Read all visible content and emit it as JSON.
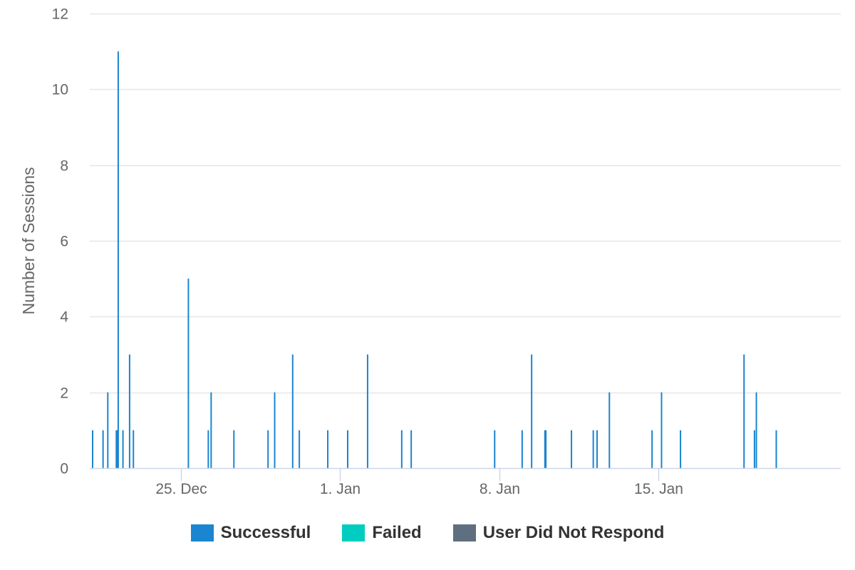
{
  "chart_data": {
    "type": "bar",
    "ylabel": "Number of Sessions",
    "ylim": [
      0,
      12
    ],
    "yticks": [
      0,
      2,
      4,
      6,
      8,
      10,
      12
    ],
    "x_range": [
      "2024-12-21",
      "2025-01-23"
    ],
    "xticks": [
      {
        "date": "2024-12-25",
        "label": "25. Dec"
      },
      {
        "date": "2025-01-01",
        "label": "1. Jan"
      },
      {
        "date": "2025-01-08",
        "label": "8. Jan"
      },
      {
        "date": "2025-01-15",
        "label": "15. Jan"
      }
    ],
    "legend_position": "bottom",
    "series": [
      {
        "name": "Successful",
        "color": "#1a85d0",
        "points": [
          {
            "x": "2024-12-21 03:00",
            "y": 1
          },
          {
            "x": "2024-12-21 14:00",
            "y": 1
          },
          {
            "x": "2024-12-21 19:00",
            "y": 2
          },
          {
            "x": "2024-12-22 04:00",
            "y": 1
          },
          {
            "x": "2024-12-22 05:00",
            "y": 1
          },
          {
            "x": "2024-12-22 06:00",
            "y": 11
          },
          {
            "x": "2024-12-22 11:00",
            "y": 1
          },
          {
            "x": "2024-12-22 18:00",
            "y": 3
          },
          {
            "x": "2024-12-22 22:00",
            "y": 1
          },
          {
            "x": "2024-12-25 08:00",
            "y": 5
          },
          {
            "x": "2024-12-26 05:00",
            "y": 1
          },
          {
            "x": "2024-12-26 08:00",
            "y": 2
          },
          {
            "x": "2024-12-27 08:00",
            "y": 1
          },
          {
            "x": "2024-12-28 20:00",
            "y": 1
          },
          {
            "x": "2024-12-29 03:00",
            "y": 2
          },
          {
            "x": "2024-12-29 22:00",
            "y": 3
          },
          {
            "x": "2024-12-30 05:00",
            "y": 1
          },
          {
            "x": "2024-12-31 11:00",
            "y": 1
          },
          {
            "x": "2025-01-01 08:00",
            "y": 1
          },
          {
            "x": "2025-01-02 05:00",
            "y": 3
          },
          {
            "x": "2025-01-03 17:00",
            "y": 1
          },
          {
            "x": "2025-01-04 03:00",
            "y": 1
          },
          {
            "x": "2025-01-07 19:00",
            "y": 1
          },
          {
            "x": "2025-01-09 00:00",
            "y": 1
          },
          {
            "x": "2025-01-09 10:00",
            "y": 3
          },
          {
            "x": "2025-01-10 00:00",
            "y": 1
          },
          {
            "x": "2025-01-10 01:00",
            "y": 1
          },
          {
            "x": "2025-01-11 04:00",
            "y": 1
          },
          {
            "x": "2025-01-12 03:00",
            "y": 1
          },
          {
            "x": "2025-01-12 07:00",
            "y": 1
          },
          {
            "x": "2025-01-12 20:00",
            "y": 2
          },
          {
            "x": "2025-01-14 17:00",
            "y": 1
          },
          {
            "x": "2025-01-15 03:00",
            "y": 2
          },
          {
            "x": "2025-01-15 23:00",
            "y": 1
          },
          {
            "x": "2025-01-18 18:00",
            "y": 3
          },
          {
            "x": "2025-01-19 05:00",
            "y": 1
          },
          {
            "x": "2025-01-19 07:00",
            "y": 2
          },
          {
            "x": "2025-01-20 04:00",
            "y": 1
          }
        ]
      },
      {
        "name": "Failed",
        "color": "#00cdbf",
        "points": []
      },
      {
        "name": "User Did Not Respond",
        "color": "#5f6f7f",
        "points": []
      }
    ]
  }
}
